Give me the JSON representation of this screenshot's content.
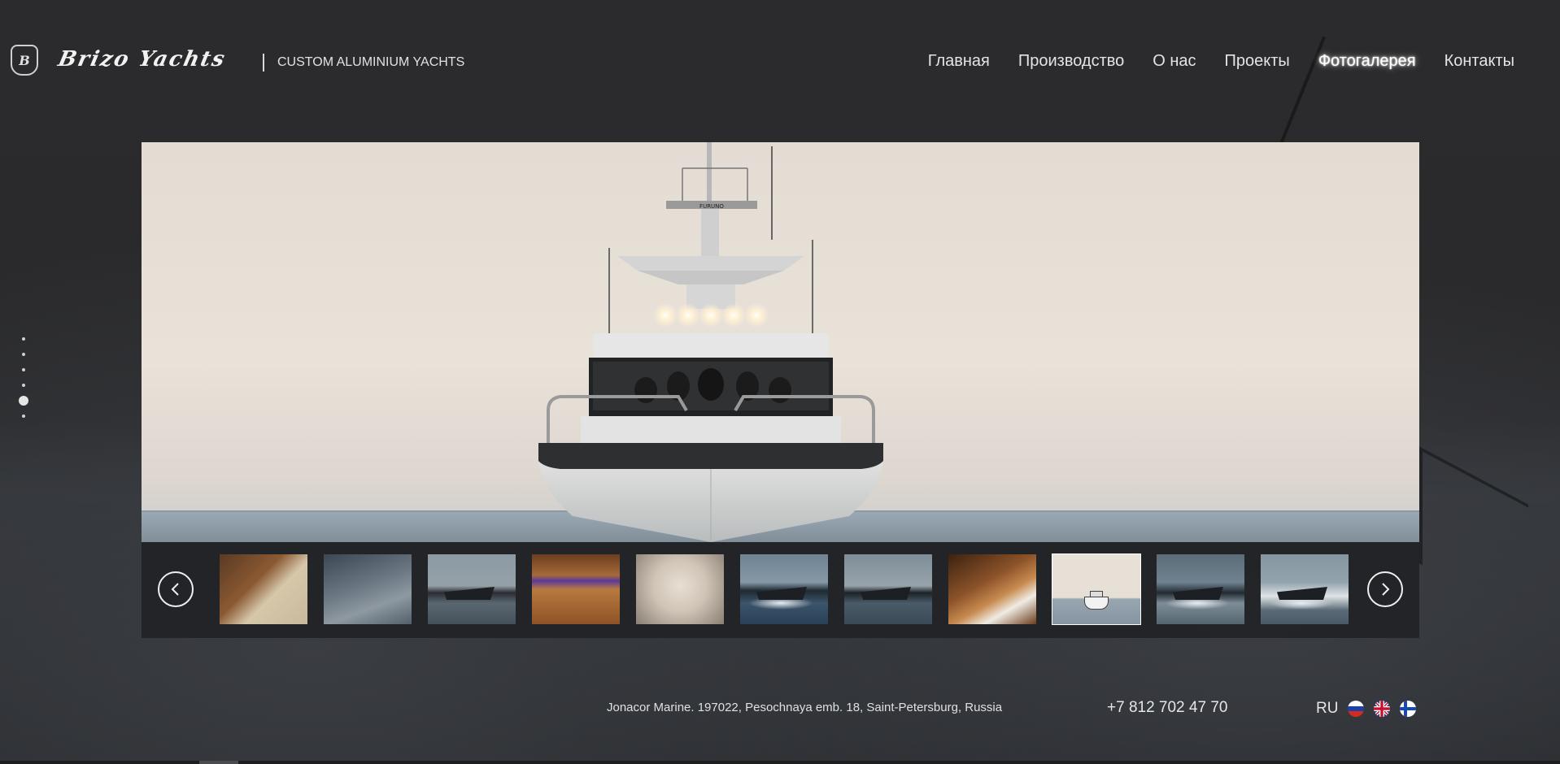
{
  "brand": {
    "logo_icon": "brizo-badge-icon",
    "badge_text": "B",
    "name": "Brizo Yachts",
    "tagline": "CUSTOM ALUMINIUM YACHTS"
  },
  "nav": {
    "items": [
      {
        "label": "Главная",
        "active": false
      },
      {
        "label": "Производство",
        "active": false
      },
      {
        "label": "О нас",
        "active": false
      },
      {
        "label": "Проекты",
        "active": false
      },
      {
        "label": "Фотогалерея",
        "active": true
      },
      {
        "label": "Контакты",
        "active": false
      }
    ]
  },
  "side_nav": {
    "dot_count": 6,
    "active_index": 4
  },
  "gallery": {
    "main_photo": "yacht-front-view-sunset",
    "main_photo_mast_text": "FURUNO",
    "prev_icon": "chevron-left-icon",
    "next_icon": "chevron-right-icon",
    "thumbnails": [
      {
        "subject": "helm-seats-interior"
      },
      {
        "subject": "aft-deck-railing"
      },
      {
        "subject": "yacht-running-side"
      },
      {
        "subject": "teak-cockpit-table"
      },
      {
        "subject": "leather-seats"
      },
      {
        "subject": "yacht-speeding-blue"
      },
      {
        "subject": "yacht-speeding-grey"
      },
      {
        "subject": "galley-interior"
      },
      {
        "subject": "yacht-front-view-sunset"
      },
      {
        "subject": "yacht-spray-dark"
      },
      {
        "subject": "yacht-spray-light"
      }
    ],
    "active_thumbnail": 8
  },
  "footer": {
    "address": "Jonacor Marine. 197022, Pesochnaya emb. 18, Saint-Petersburg, Russia",
    "phone": "+7 812 702 47 70",
    "language": "RU",
    "flags": [
      "russia-flag-icon",
      "uk-flag-icon",
      "finland-flag-icon"
    ]
  },
  "colors": {
    "background": "#2a2a2c",
    "strip": "#222326",
    "text": "#e8e8e8"
  }
}
